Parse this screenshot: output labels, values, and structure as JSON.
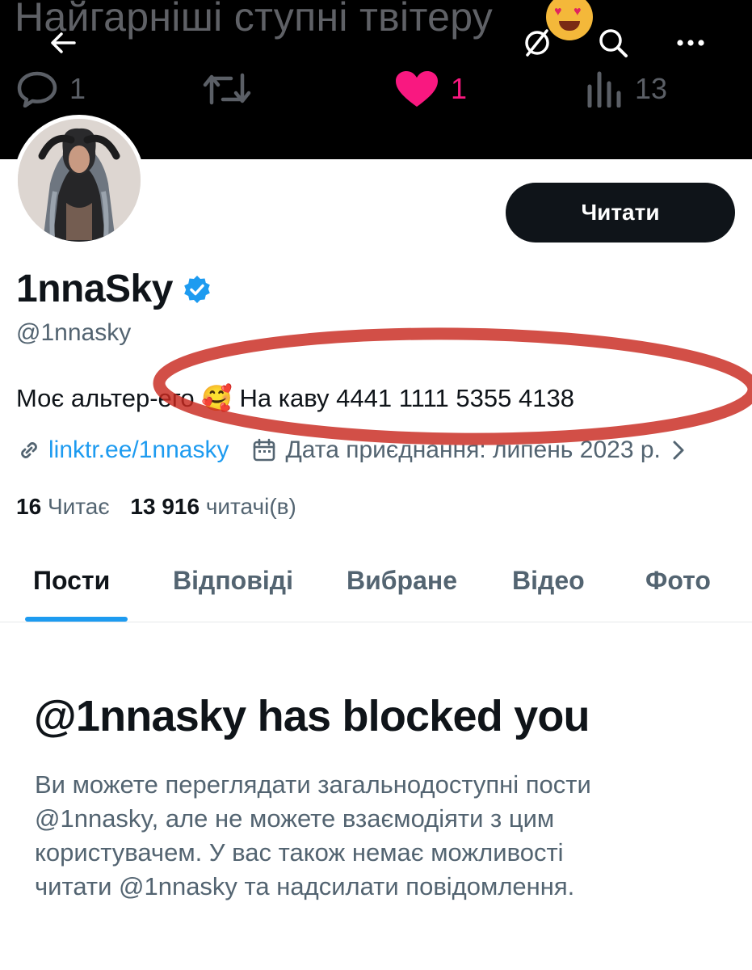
{
  "banner": {
    "text": "Найгарніші ступні твітеру",
    "emoji": "heart-eyes-emoji",
    "stats": {
      "replies": "1",
      "likes": "1",
      "views": "13"
    }
  },
  "profile": {
    "follow_label": "Читати",
    "display_name": "1nnaSky",
    "handle": "@1nnasky",
    "bio_before": "Моє альтер-его",
    "bio_emoji": "🥰",
    "bio_after": "На каву 4441 1111 5355 4138",
    "link": "linktr.ee/1nnasky",
    "joined": "Дата приєднання: липень 2023 р.",
    "following_count": "16",
    "following_label": "Читає",
    "followers_count": "13 916",
    "followers_label": "читачі(в)"
  },
  "tabs": [
    "Пости",
    "Відповіді",
    "Вибране",
    "Відео",
    "Фото"
  ],
  "blocked": {
    "title": "@1nnasky has blocked you",
    "line1": "Ви можете переглядати загальнодоступні пости",
    "line2": "@1nnasky, але не можете взаємодіяти з цим",
    "line3": "користувачем. У вас також немає можливості",
    "line4": "читати @1nnasky та надсилати повідомлення."
  },
  "colors": {
    "accent": "#1d9bf0",
    "like": "#f91880",
    "annotation": "#c8281e"
  }
}
